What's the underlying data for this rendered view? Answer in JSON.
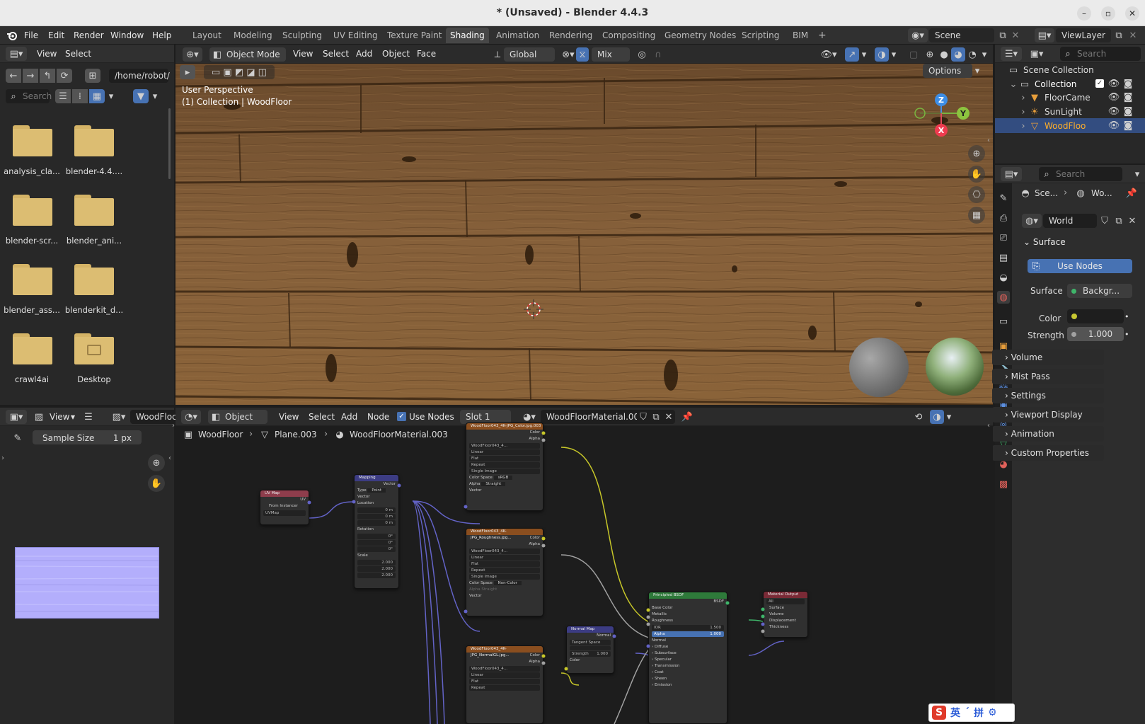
{
  "window": {
    "title": "* (Unsaved) - Blender 4.4.3",
    "minimize": "–",
    "maximize": "▫",
    "close": "✕"
  },
  "menus": [
    "File",
    "Edit",
    "Render",
    "Window",
    "Help"
  ],
  "workspaces": [
    "Layout",
    "Modeling",
    "Sculpting",
    "UV Editing",
    "Texture Paint",
    "Shading",
    "Animation",
    "Rendering",
    "Compositing",
    "Geometry Nodes",
    "Scripting",
    "BIM",
    "+"
  ],
  "active_workspace": "Shading",
  "scene": "Scene",
  "view_layer": "ViewLayer",
  "file_browser": {
    "menus": [
      "View",
      "Select"
    ],
    "path": "/home/robot/",
    "search_placeholder": "Search",
    "folders": [
      "analysis_cla...",
      "blender-4.4....",
      "blender-scr...",
      "blender_ani...",
      "blender_ass...",
      "blenderkit_d...",
      "crawl4ai",
      "Desktop"
    ]
  },
  "viewport": {
    "mode": "Object Mode",
    "menus": [
      "View",
      "Select",
      "Add",
      "Object",
      "Face"
    ],
    "orientation": "Global",
    "snap_mix": "Mix",
    "options": "Options",
    "overlay_line1": "User Perspective",
    "overlay_line2": "(1) Collection | WoodFloor",
    "gizmo": {
      "z": "Z",
      "y": "Y",
      "x": "X"
    }
  },
  "outliner": {
    "search_placeholder": "Search",
    "scene_collection": "Scene Collection",
    "collection": "Collection",
    "items": [
      "FloorCame",
      "SunLight",
      "WoodFloo"
    ]
  },
  "properties": {
    "search_placeholder": "Search",
    "breadcrumb": [
      "Sce...",
      "Wo..."
    ],
    "world_name": "World",
    "surface_panel": "Surface",
    "use_nodes": "Use Nodes",
    "surface_label": "Surface",
    "surface_value": "Backgr...",
    "color_label": "Color",
    "strength_label": "Strength",
    "strength_value": "1.000",
    "panels": [
      "Volume",
      "Mist Pass",
      "Settings",
      "Viewport Display",
      "Animation",
      "Custom Properties"
    ]
  },
  "image_editor": {
    "view": "View",
    "image_name": "WoodFloc",
    "sample_size_label": "Sample Size",
    "sample_size_value": "1 px"
  },
  "node_editor": {
    "object": "Object",
    "menus": [
      "View",
      "Select",
      "Add",
      "Node"
    ],
    "use_nodes": "Use Nodes",
    "slot": "Slot 1",
    "material": "WoodFloorMaterial.003",
    "breadcrumb": [
      "WoodFloor",
      "Plane.003",
      "WoodFloorMaterial.003"
    ],
    "nodes": {
      "uvmap": {
        "title": "UV Map",
        "out": "UV",
        "from_instancer": "From Instancer",
        "uvmap": "UVMap"
      },
      "mapping": {
        "title": "Mapping",
        "out": "Vector",
        "type_label": "Type",
        "type": "Point",
        "vector": "Vector",
        "location": "Location",
        "rotation": "Rotation",
        "scale": "Scale",
        "loc": [
          "0 m",
          "0 m",
          "0 m"
        ],
        "rot": [
          "0°",
          "0°",
          "0°"
        ],
        "scl": [
          "2.000",
          "2.000",
          "2.000"
        ]
      },
      "color_tex": {
        "title": "WoodFloor043_4K-JPG_Color.jpg.003",
        "file": "WoodFloor043_4...",
        "interp": "Linear",
        "proj": "Flat",
        "ext": "Repeat",
        "src": "Single Image",
        "cs_label": "Color Space",
        "cs": "sRGB",
        "alpha_label": "Alpha",
        "alpha": "Straight"
      },
      "rough_tex": {
        "title": "WoodFloor043_4K-JPG_Roughness.jpg...",
        "file": "WoodFloor043_4...",
        "interp": "Linear",
        "proj": "Flat",
        "ext": "Repeat",
        "src": "Single Image",
        "cs_label": "Color Space",
        "cs": "Non-Color",
        "alpha_label": "Alpha",
        "alpha": "Straight"
      },
      "normal_tex": {
        "title": "WoodFloor043_4K-JPG_NormalGL.jpg...",
        "file": "WoodFloor043_4...",
        "interp": "Linear",
        "proj": "Flat",
        "ext": "Repeat"
      },
      "normalmap": {
        "title": "Normal Map",
        "out": "Normal",
        "space": "Tangent Space",
        "strength_label": "Strength",
        "strength": "1.000",
        "color": "Color"
      },
      "bsdf": {
        "title": "Principled BSDF",
        "out": "BSDF",
        "base": "Base Color",
        "metallic": "Metallic",
        "roughness": "Roughness",
        "ior_label": "IOR",
        "ior": "1.500",
        "alpha_label": "Alpha",
        "alpha": "1.000",
        "normal": "Normal",
        "subs": [
          "Diffuse",
          "Subsurface",
          "Specular",
          "Transmission",
          "Coat",
          "Sheen",
          "Emission"
        ]
      },
      "output": {
        "title": "Material Output",
        "target": "All",
        "sockets": [
          "Surface",
          "Volume",
          "Displacement",
          "Thickness"
        ]
      }
    },
    "socket_labels": {
      "color": "Color",
      "alpha": "Alpha",
      "vector": "Vector"
    }
  },
  "ime": {
    "s": "S",
    "en": "英",
    "punct": "ˊ",
    "pin": "拼",
    "gear": "⚙"
  },
  "colors": {
    "accent": "#4772b3",
    "highlight": "#334d80",
    "wood": "#7a5431"
  }
}
